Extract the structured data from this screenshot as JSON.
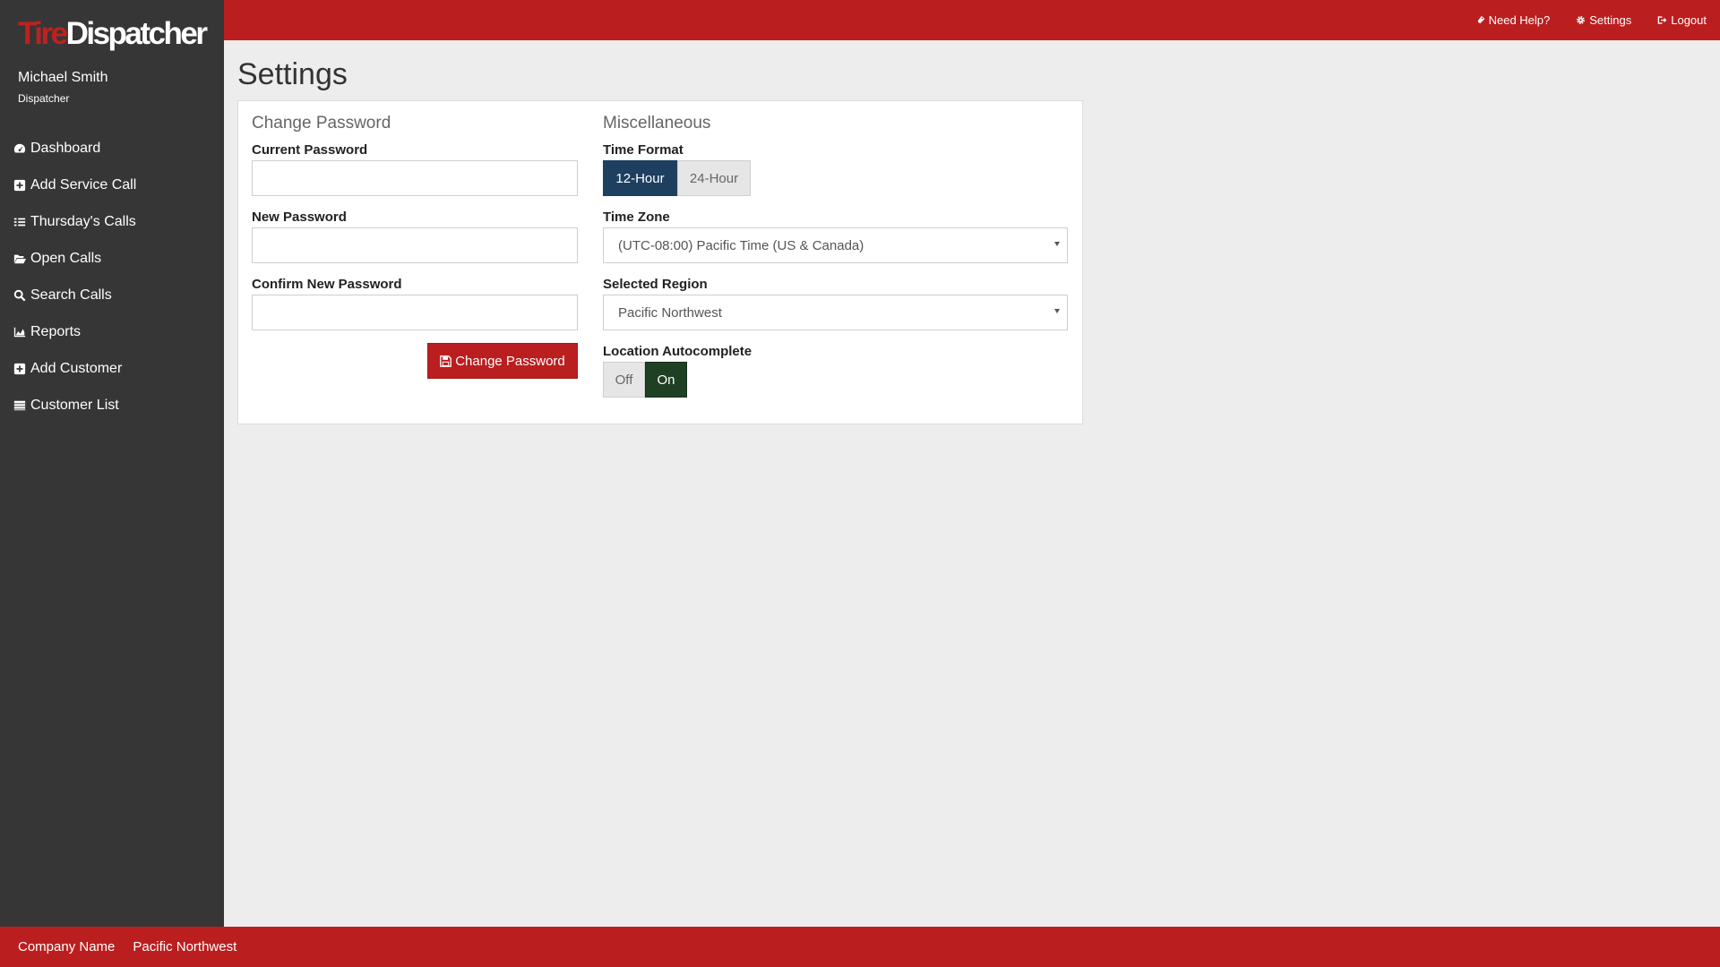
{
  "brand": {
    "part1": "Tire",
    "part2": "Dispatcher"
  },
  "user": {
    "name": "Michael Smith",
    "role": "Dispatcher"
  },
  "sidebar": {
    "items": [
      {
        "label": "Dashboard",
        "icon": "dashboard-icon"
      },
      {
        "label": "Add Service Call",
        "icon": "plus-square-icon"
      },
      {
        "label": "Thursday's Calls",
        "icon": "list-icon"
      },
      {
        "label": "Open Calls",
        "icon": "folder-open-icon"
      },
      {
        "label": "Search Calls",
        "icon": "search-icon"
      },
      {
        "label": "Reports",
        "icon": "area-chart-icon"
      },
      {
        "label": "Add Customer",
        "icon": "plus-square-icon"
      },
      {
        "label": "Customer List",
        "icon": "table-list-icon"
      }
    ]
  },
  "topbar": {
    "links": [
      {
        "label": "Need Help?",
        "icon": "life-ring-icon"
      },
      {
        "label": "Settings",
        "icon": "gear-icon"
      },
      {
        "label": "Logout",
        "icon": "sign-out-icon"
      }
    ]
  },
  "page": {
    "title": "Settings"
  },
  "change_password": {
    "section_title": "Change Password",
    "current_label": "Current Password",
    "current_value": "",
    "new_label": "New Password",
    "new_value": "",
    "confirm_label": "Confirm New Password",
    "confirm_value": "",
    "button_label": "Change Password"
  },
  "misc": {
    "section_title": "Miscellaneous",
    "time_format_label": "Time Format",
    "time_format_options": [
      "12-Hour",
      "24-Hour"
    ],
    "time_format_selected": "12-Hour",
    "time_zone_label": "Time Zone",
    "time_zone_value": "(UTC-08:00) Pacific Time (US & Canada)",
    "region_label": "Selected Region",
    "region_value": "Pacific Northwest",
    "autocomplete_label": "Location Autocomplete",
    "autocomplete_options": [
      "Off",
      "On"
    ],
    "autocomplete_selected": "On"
  },
  "footer": {
    "company": "Company Name",
    "region": "Pacific Northwest"
  },
  "colors": {
    "brand_red": "#bb1e1f",
    "sidebar_bg": "#363636",
    "page_bg": "#ededed",
    "active_blue": "#1e3f60",
    "active_green": "#204024"
  }
}
